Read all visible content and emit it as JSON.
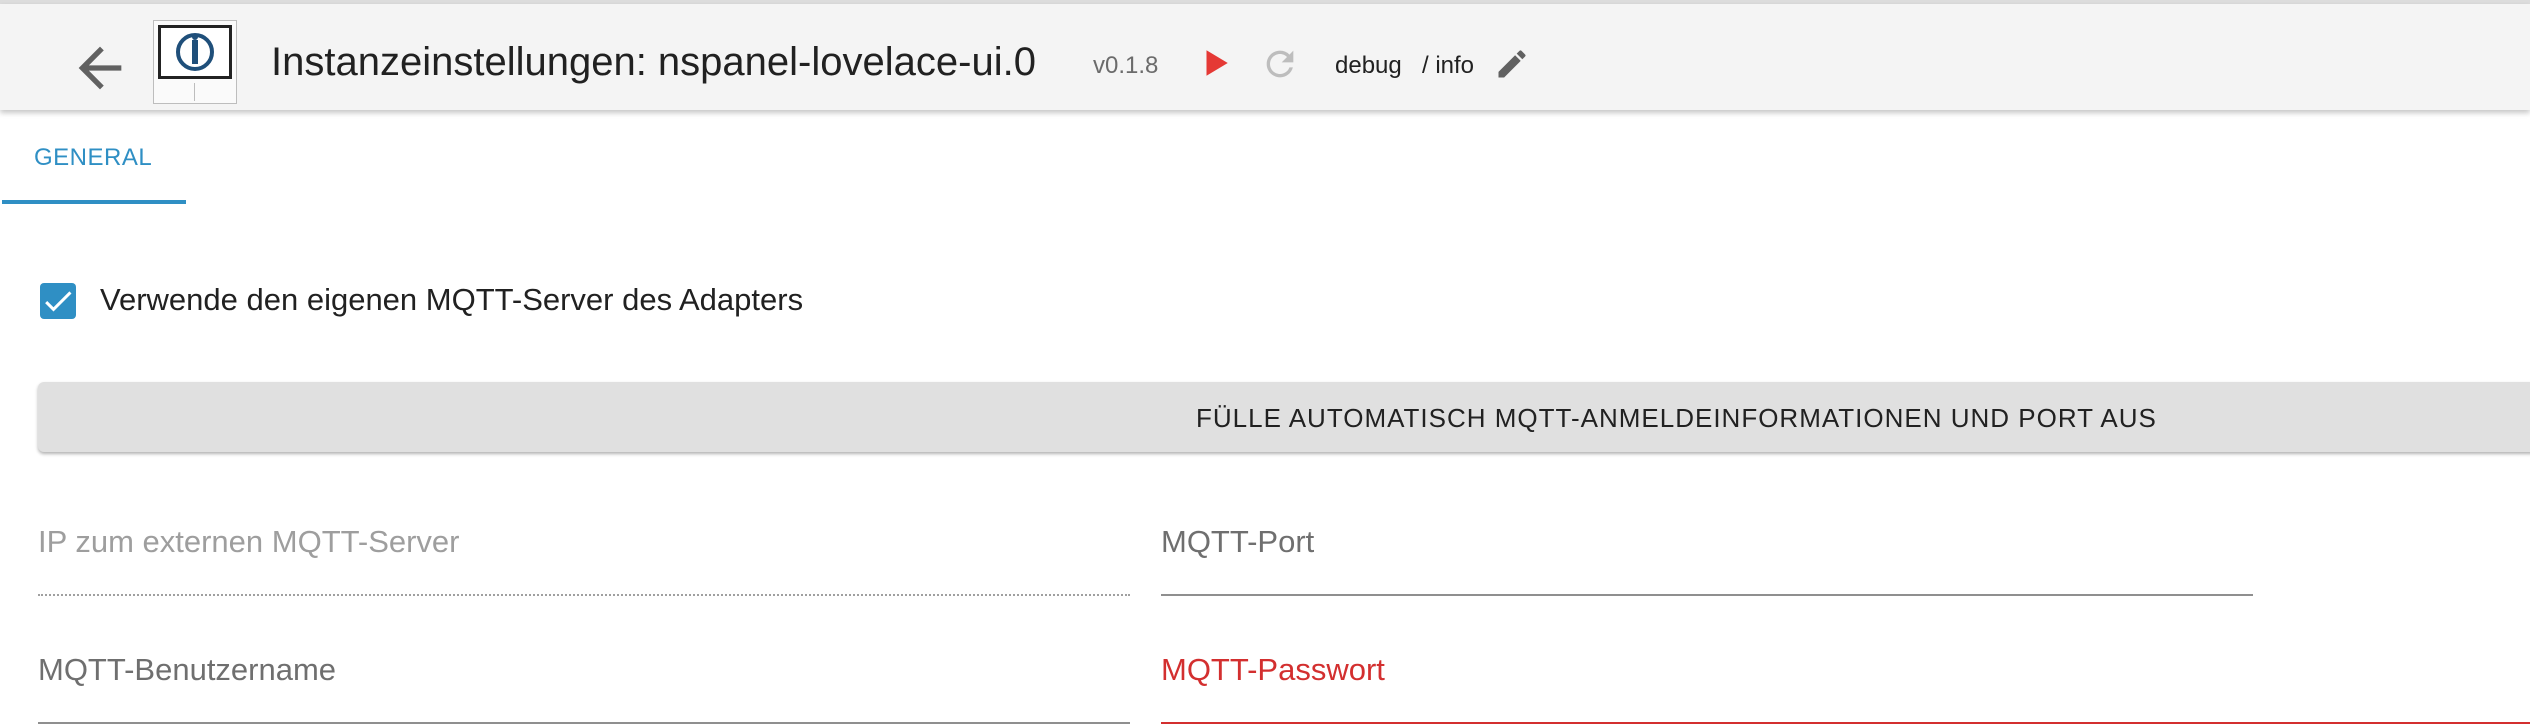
{
  "header": {
    "title": "Instanzeinstellungen: nspanel-lovelace-ui.0",
    "version": "v0.1.8",
    "log_level": "debug",
    "log_info": "/ info",
    "icons": {
      "back": "arrow-back-icon",
      "logo": "adapter-logo-icon",
      "play": "play-icon",
      "reload": "reload-icon",
      "edit": "pencil-icon"
    },
    "colors": {
      "play": "#e53935",
      "reload_disabled": "#bdbdbd"
    }
  },
  "tabs": [
    {
      "label": "GENERAL",
      "active": true
    }
  ],
  "form": {
    "use_own_mqtt": {
      "label": "Verwende den eigenen MQTT-Server des Adapters",
      "checked": true
    },
    "autofill_button": "FÜLLE AUTOMATISCH MQTT-ANMELDEINFORMATIONEN UND PORT AUS",
    "ip_field": {
      "label": "IP zum externen MQTT-Server",
      "value": "",
      "disabled": true
    },
    "port_field": {
      "label": "MQTT-Port",
      "value": ""
    },
    "user_field": {
      "label": "MQTT-Benutzername",
      "value": ""
    },
    "password_field": {
      "label": "MQTT-Passwort",
      "value": "",
      "error": true
    }
  },
  "colors": {
    "accent": "#2f8fc4",
    "error": "#d32f2f"
  }
}
